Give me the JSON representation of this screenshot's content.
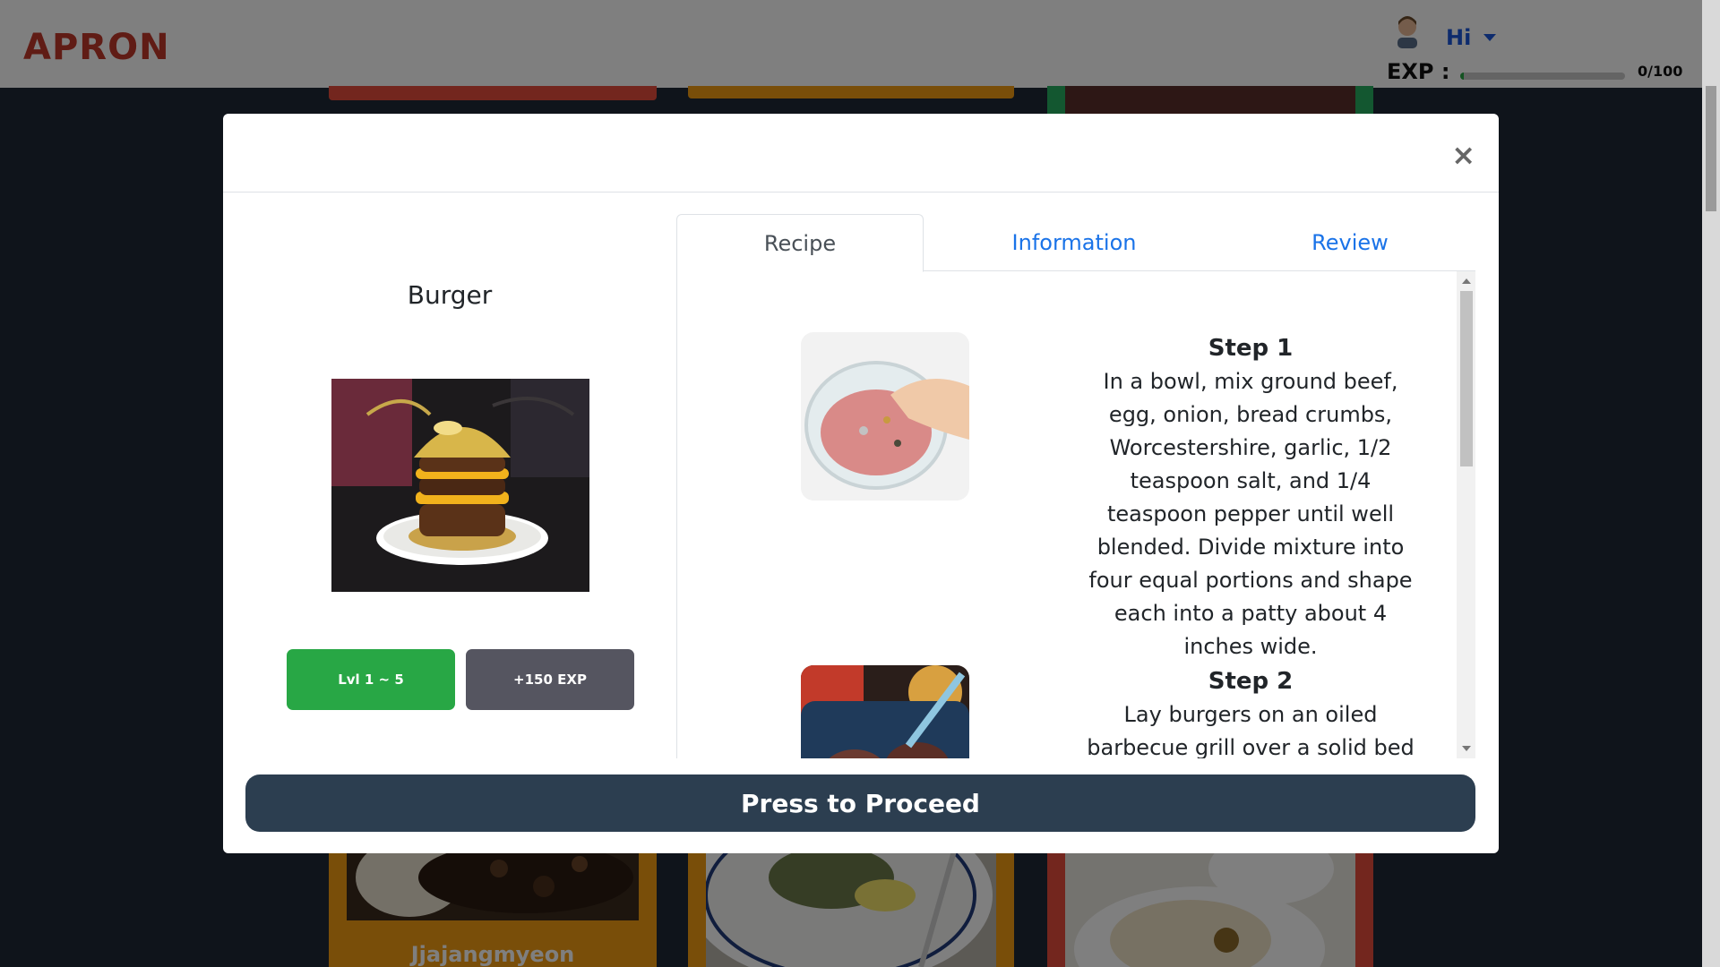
{
  "navbar": {
    "brand": "APRON",
    "user_greeting": "Hi",
    "exp_label": "EXP :",
    "exp_value": "0/100",
    "exp_progress": 0.02
  },
  "background_cards": [
    {
      "title": "Jjajangmyeon",
      "border_color": "#f39c12"
    },
    {
      "title": "",
      "border_color": "#f39c12"
    },
    {
      "title": "",
      "border_color": "#e74c3c"
    }
  ],
  "modal": {
    "close_label": "×",
    "dish_name": "Burger",
    "level_badge": "Lvl 1 ~ 5",
    "exp_badge": "+150 EXP",
    "tabs": [
      {
        "label": "Recipe",
        "active": true
      },
      {
        "label": "Information",
        "active": false
      },
      {
        "label": "Review",
        "active": false
      }
    ],
    "steps": [
      {
        "title": "Step 1",
        "text": "In a bowl, mix ground beef, egg, onion, bread crumbs, Worcestershire, garlic, 1/2 teaspoon salt, and 1/4 teaspoon pepper until well blended. Divide mixture into four equal portions and shape each into a patty about 4 inches wide."
      },
      {
        "title": "Step 2",
        "text": "Lay burgers on an oiled barbecue grill over a solid bed of"
      }
    ],
    "proceed_label": "Press to Proceed"
  },
  "colors": {
    "brand": "#c0392b",
    "link": "#1a73e8",
    "level_badge": "#28a745",
    "exp_badge": "#555560",
    "proceed_button": "#2c3e50"
  }
}
